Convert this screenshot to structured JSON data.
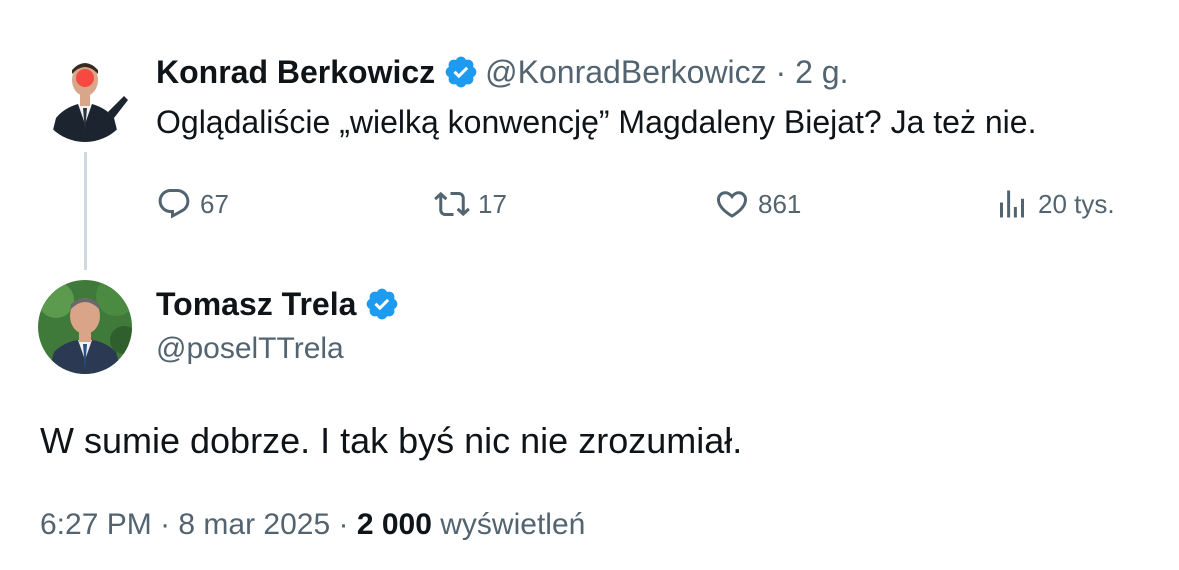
{
  "parent": {
    "name": "Konrad Berkowicz",
    "handle": "@KonradBerkowicz",
    "separator": " · ",
    "time_ago": "2 g.",
    "text": "Oglądaliście „wielką konwencję” Magdaleny Biejat? Ja też nie.",
    "actions": {
      "replies": "67",
      "retweets": "17",
      "likes": "861",
      "views": "20 tys."
    }
  },
  "reply": {
    "name": "Tomasz Trela",
    "handle": "@poselTTrela",
    "text": "W sumie dobrze. I tak byś nic nie zrozumiał.",
    "time": "6:27 PM",
    "date": "8 mar 2025",
    "views_count": "2 000",
    "views_label": "wyświetleń"
  },
  "colors": {
    "verified": "#1d9bf0",
    "text": "#0f1419",
    "muted": "#536471",
    "thread_line": "#cfd9de"
  }
}
